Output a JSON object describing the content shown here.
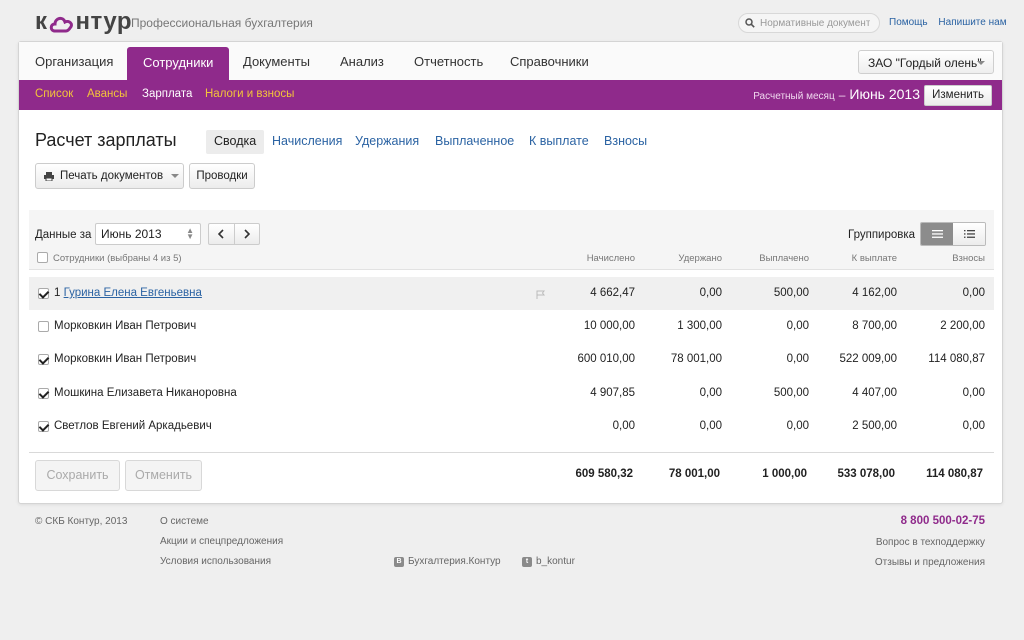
{
  "brand": {
    "logo_text_left": "к",
    "logo_text_right": "нтур",
    "tagline": "Профессиональная бухгалтерия",
    "accent_color": "#8f2a8b"
  },
  "header": {
    "search_placeholder": "Нормативные документы",
    "help_link": "Помощь",
    "write_link": "Напишите нам"
  },
  "main_tabs": [
    {
      "label": "Организация",
      "active": false
    },
    {
      "label": "Сотрудники",
      "active": true
    },
    {
      "label": "Документы",
      "active": false
    },
    {
      "label": "Анализ",
      "active": false
    },
    {
      "label": "Отчетность",
      "active": false
    },
    {
      "label": "Справочники",
      "active": false
    }
  ],
  "company": "ЗАО \"Гордый олень\"",
  "sub_nav": [
    {
      "label": "Список",
      "active": false
    },
    {
      "label": "Авансы",
      "active": false
    },
    {
      "label": "Зарплата",
      "active": true
    },
    {
      "label": "Налоги и взносы",
      "active": false
    }
  ],
  "period": {
    "label": "Расчетный месяц",
    "dash": "–",
    "month": "Июнь 2013",
    "change_button": "Изменить"
  },
  "page": {
    "title": "Расчет зарплаты",
    "sub_tabs": [
      {
        "label": "Сводка",
        "active": true
      },
      {
        "label": "Начисления",
        "active": false
      },
      {
        "label": "Удержания",
        "active": false
      },
      {
        "label": "Выплаченное",
        "active": false
      },
      {
        "label": "К выплате",
        "active": false
      },
      {
        "label": "Взносы",
        "active": false
      }
    ],
    "print_button": "Печать документов",
    "postings_button": "Проводки"
  },
  "grid": {
    "data_for_label": "Данные за",
    "month_value": "Июнь 2013",
    "grouping_label": "Группировка",
    "employees_header": "Сотрудники (выбраны 4 из 5)",
    "columns": [
      "Начислено",
      "Удержано",
      "Выплачено",
      "К выплате",
      "Взносы"
    ],
    "rows": [
      {
        "checked": true,
        "index": "1",
        "name": "Гурина Елена Евгеньевна",
        "link": true,
        "highlighted": true,
        "values": [
          "4 662,47",
          "0,00",
          "500,00",
          "4 162,00",
          "0,00"
        ]
      },
      {
        "checked": false,
        "index": "",
        "name": "Морковкин Иван Петрович",
        "link": false,
        "highlighted": false,
        "values": [
          "10 000,00",
          "1 300,00",
          "0,00",
          "8 700,00",
          "2 200,00"
        ]
      },
      {
        "checked": true,
        "index": "",
        "name": "Морковкин Иван Петрович",
        "link": false,
        "highlighted": false,
        "values": [
          "600 010,00",
          "78 001,00",
          "0,00",
          "522 009,00",
          "114 080,87"
        ]
      },
      {
        "checked": true,
        "index": "",
        "name": "Мошкина Елизавета Никаноровна",
        "link": false,
        "highlighted": false,
        "values": [
          "4 907,85",
          "0,00",
          "500,00",
          "4 407,00",
          "0,00"
        ]
      },
      {
        "checked": true,
        "index": "",
        "name": "Светлов Евгений Аркадьевич",
        "link": false,
        "highlighted": false,
        "values": [
          "0,00",
          "0,00",
          "0,00",
          "2 500,00",
          "0,00"
        ]
      }
    ],
    "totals": [
      "609 580,32",
      "78 001,00",
      "1 000,00",
      "533 078,00",
      "114 080,87"
    ],
    "save_button": "Сохранить",
    "cancel_button": "Отменить"
  },
  "footer": {
    "copyright": "© СКБ Контур, 2013",
    "links": [
      "О системе",
      "Акции и спецпредложения",
      "Условия использования"
    ],
    "vk": "Бухгалтерия.Контур",
    "twitter": "b_kontur",
    "phone": "8 800 500-02-75",
    "support": "Вопрос в техподдержку",
    "feedback": "Отзывы и предложения"
  }
}
